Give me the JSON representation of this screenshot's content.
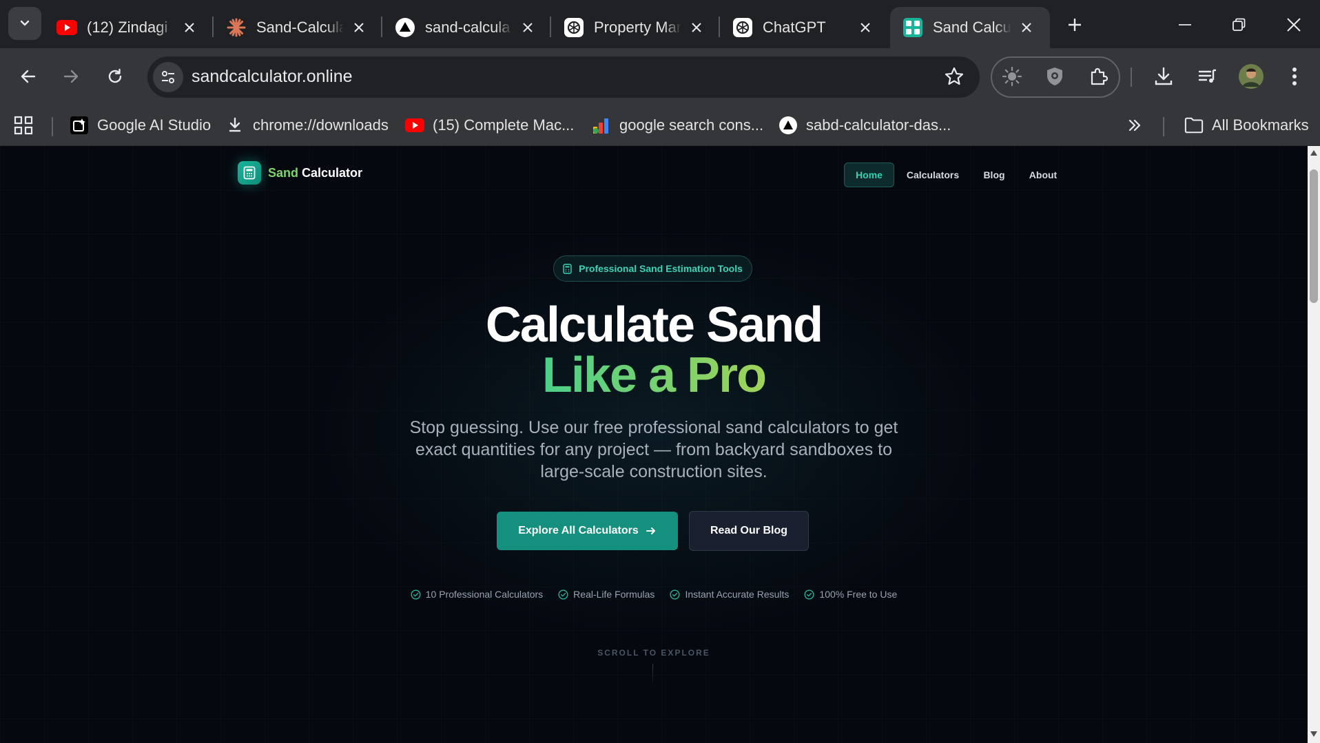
{
  "browser": {
    "tabs": [
      {
        "title": "(12) Zindagi",
        "icon": "youtube-icon"
      },
      {
        "title": "Sand-Calcula",
        "icon": "claude-icon"
      },
      {
        "title": "sand-calcula",
        "icon": "vercel-icon"
      },
      {
        "title": "Property Mar",
        "icon": "chatgpt-icon"
      },
      {
        "title": "ChatGPT",
        "icon": "chatgpt-icon"
      },
      {
        "title": "Sand Calcula",
        "icon": "sand-calculator-favicon",
        "active": true
      }
    ],
    "url": "sandcalculator.online",
    "bookmarks": [
      {
        "label": "Google AI Studio",
        "icon": "ai-studio-icon"
      },
      {
        "label": "chrome://downloads",
        "icon": "download-icon"
      },
      {
        "label": "(15) Complete Mac...",
        "icon": "youtube-icon"
      },
      {
        "label": "google search cons...",
        "icon": "search-console-icon"
      },
      {
        "label": "sabd-calculator-das...",
        "icon": "vercel-icon"
      }
    ],
    "all_bookmarks_label": "All Bookmarks"
  },
  "site": {
    "brand": {
      "word1": "Sand",
      "word2": "Calculator"
    },
    "nav": [
      {
        "label": "Home",
        "active": true
      },
      {
        "label": "Calculators"
      },
      {
        "label": "Blog"
      },
      {
        "label": "About"
      }
    ],
    "hero": {
      "badge": "Professional Sand Estimation Tools",
      "title_line1": "Calculate Sand",
      "title_line2": "Like a Pro",
      "subtitle": "Stop guessing. Use our free professional sand calculators to get exact quantities for any project — from backyard sandboxes to large-scale construction sites.",
      "primary_cta": "Explore All Calculators",
      "secondary_cta": "Read Our Blog",
      "features": [
        "10 Professional Calculators",
        "Real-Life Formulas",
        "Instant Accurate Results",
        "100% Free to Use"
      ],
      "scroll_hint": "SCROLL TO EXPLORE"
    }
  },
  "colors": {
    "accent": "#15907e",
    "teal_text": "#3fd3b6",
    "gradient_start": "#4ccf88",
    "gradient_end": "#9fd35a",
    "page_bg": "#05080f"
  }
}
